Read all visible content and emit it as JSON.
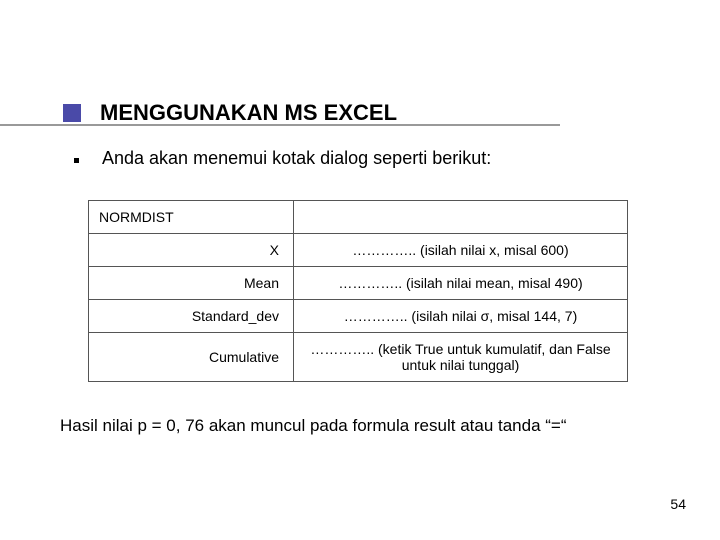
{
  "title": "MENGGUNAKAN MS EXCEL",
  "bullet": "Anda akan menemui kotak dialog seperti berikut:",
  "table": {
    "header": "NORMDIST",
    "rows": [
      {
        "label": "X",
        "value": "………….. (isilah nilai x, misal 600)"
      },
      {
        "label": "Mean",
        "value": "………….. (isilah nilai mean, misal 490)"
      },
      {
        "label": "Standard_dev",
        "value": "………….. (isilah nilai σ, misal 144, 7)"
      },
      {
        "label": "Cumulative",
        "value": "………….. (ketik True untuk kumulatif, dan False untuk nilai tunggal)"
      }
    ]
  },
  "result": "Hasil nilai p = 0, 76 akan muncul pada formula result atau tanda “=“",
  "page_number": "54"
}
